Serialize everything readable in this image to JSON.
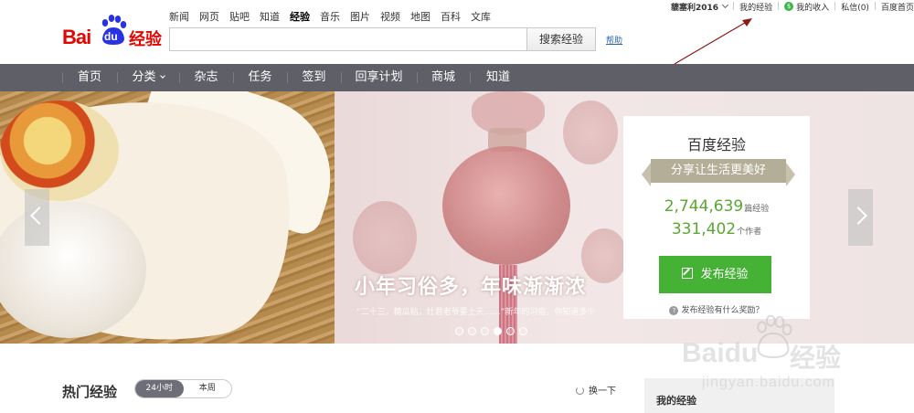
{
  "header": {
    "logo": {
      "bai": "Bai",
      "du": "du",
      "jingyan": "经验"
    },
    "topnav": [
      "新闻",
      "网页",
      "贴吧",
      "知道",
      "经验",
      "音乐",
      "图片",
      "视频",
      "地图",
      "百科",
      "文库"
    ],
    "topnav_active": "经验",
    "search": {
      "value": "",
      "placeholder": "",
      "button": "搜索经验"
    },
    "help": "帮助",
    "user_bar": {
      "username": "貔塞利2016",
      "my_experience": "我的经验",
      "my_income": "我的收入",
      "messages": "私信(0)",
      "baidu_home": "百度首页"
    }
  },
  "mainnav": {
    "items": [
      "首页",
      "分类",
      "杂志",
      "任务",
      "签到",
      "回享计划",
      "商城",
      "知道"
    ]
  },
  "banner": {
    "caption": "小年习俗多，年味渐渐浓",
    "subcaption": "“二十三，糖瓜粘，灶君老爷要上天……”新年的习俗，你知道多少",
    "dots_count": 6,
    "active_dot": 3
  },
  "card": {
    "title": "百度经验",
    "slogan": "分享让生活更美好",
    "articles_count": "2,744,639",
    "articles_unit": "篇经验",
    "authors_count": "331,402",
    "authors_unit": "个作者",
    "publish_button": "发布经验",
    "reward_link": "发布经验有什么奖励？"
  },
  "bottom": {
    "hot_title": "热门经验",
    "toggle": [
      "24小时",
      "本周"
    ],
    "toggle_active": 0,
    "refresh": "换一下",
    "my_experience_panel": "我的经验"
  },
  "watermark": {
    "brand": "Baidu",
    "jingyan": "经验",
    "url": "jingyan.baidu.com"
  },
  "colors": {
    "brand_red": "#e10601",
    "nav_bg": "#5f5f67",
    "accent_green": "#45b135",
    "stat_green": "#5aa732",
    "link_blue": "#2b64b3",
    "annotation_arrow": "#8b1a1a"
  }
}
